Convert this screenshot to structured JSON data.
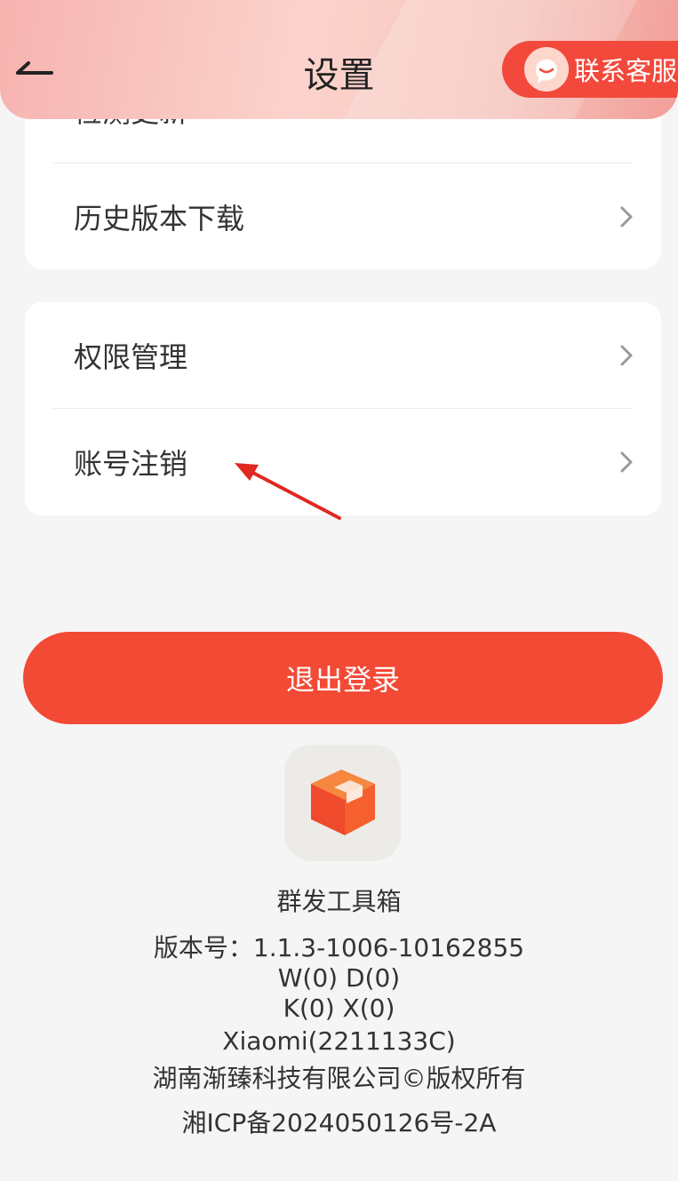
{
  "header": {
    "title": "设置",
    "service_label": "联系客服"
  },
  "settings": {
    "card1": {
      "partial_item": "检测更新",
      "history_download": "历史版本下载"
    },
    "card2": {
      "permissions": "权限管理",
      "account_cancel": "账号注销"
    }
  },
  "logout_label": "退出登录",
  "app_info": {
    "name": "群发工具箱",
    "version": "版本号：1.1.3-1006-10162855",
    "wd": "W(0) D(0)",
    "kx": "K(0) X(0)",
    "device": "Xiaomi(2211133C)",
    "copyright": "湖南渐臻科技有限公司©版权所有",
    "icp": "湘ICP备2024050126号-2A"
  },
  "colors": {
    "accent": "#f34a35",
    "annotation_arrow": "#e02820"
  },
  "icons": {
    "back": "back-arrow-icon",
    "service": "customer-service-icon",
    "chevron": "chevron-right-icon",
    "logo": "app-logo-box-icon"
  }
}
